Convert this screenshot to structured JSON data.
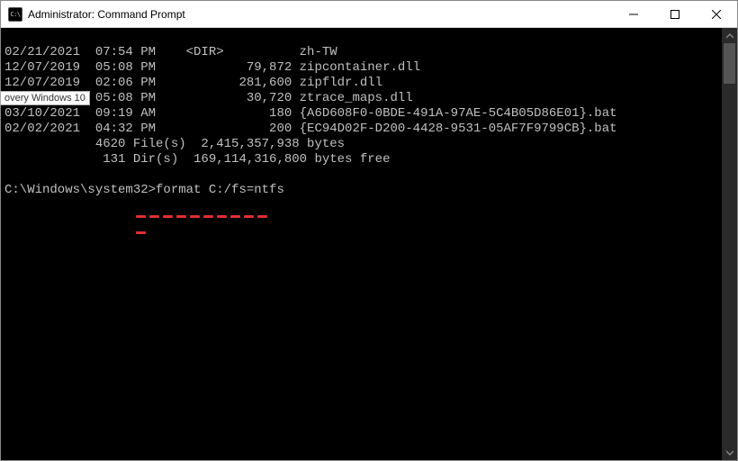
{
  "titlebar": {
    "icon_text": "C:\\",
    "title": "Administrator: Command Prompt"
  },
  "tooltip": "overy Windows 10",
  "terminal": {
    "lines": [
      "02/21/2021  07:54 PM    <DIR>          zh-TW",
      "12/07/2019  05:08 PM            79,872 zipcontainer.dll",
      "12/07/2019  02:06 PM           281,600 zipfldr.dll",
      "12/07/2019  05:08 PM            30,720 ztrace_maps.dll",
      "03/10/2021  09:19 AM               180 {A6D608F0-0BDE-491A-97AE-5C4B05D86E01}.bat",
      "02/02/2021  04:32 PM               200 {EC94D02F-D200-4428-9531-05AF7F9799CB}.bat",
      "            4620 File(s)  2,415,357,938 bytes",
      "             131 Dir(s)  169,114,316,800 bytes free",
      "",
      "C:\\Windows\\system32>format C:/fs=ntfs"
    ]
  },
  "annotation": {
    "highlighted_command": "format C:/fs=ntfs"
  }
}
